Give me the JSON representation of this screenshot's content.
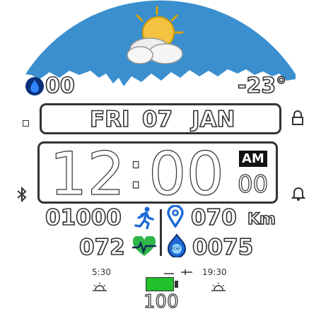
{
  "header": {
    "weather_icon": "partly-cloudy-sun-icon",
    "sky_color": "#3b8fcf",
    "humidity_value": "00",
    "temperature": "-23°"
  },
  "date": {
    "day": "FRI",
    "date": "07",
    "month": "JAN"
  },
  "time": {
    "hours": "12",
    "separator": ":",
    "minutes": "00",
    "ampm": "AM",
    "seconds": "00"
  },
  "stats": {
    "steps": "01000",
    "distance": "070",
    "distance_unit": "Km",
    "heart_rate": "072",
    "calories": "0075",
    "calories_badge": "kcal"
  },
  "sun": {
    "sunrise": "5:30",
    "sunset": "19:30"
  },
  "battery": {
    "level": 100,
    "label": "100",
    "color": "#22c02a"
  },
  "side_icons": {
    "left_top": "square-icon",
    "left_bottom": "bluetooth-icon",
    "right_top": "lock-icon",
    "right_bottom": "bell-icon"
  }
}
